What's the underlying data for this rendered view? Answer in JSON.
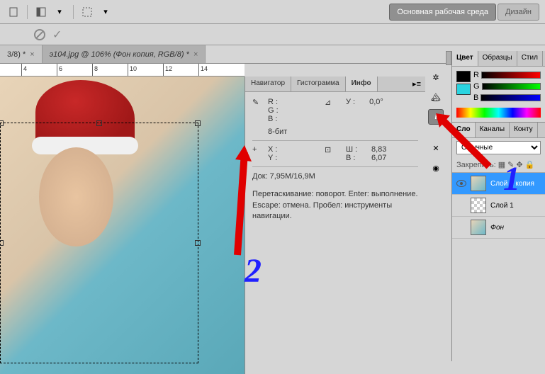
{
  "toolbar": {
    "workspace_active": "Основная рабочая среда",
    "workspace_design": "Дизайн"
  },
  "documents": {
    "tab1": "3/8) *",
    "tab2": "э104.jpg @ 106% (Фон копия, RGB/8) *"
  },
  "ruler": {
    "t4": "4",
    "t6": "6",
    "t8": "8",
    "t10": "10",
    "t12": "12",
    "t14": "14"
  },
  "info_panel": {
    "tab_nav": "Навигатор",
    "tab_hist": "Гистограмма",
    "tab_info": "Инфо",
    "r_label": "R :",
    "g_label": "G :",
    "b_label": "B :",
    "bit_depth": "8-бит",
    "x_label": "X :",
    "y_label": "Y :",
    "angle_label": "У :",
    "angle_value": "0,0°",
    "w_label": "Ш :",
    "w_value": "8,83",
    "h_label": "В :",
    "h_value": "6,07",
    "doc_size": "Док: 7,95M/16,9M",
    "hint": "Перетаскивание: поворот. Enter: выполнение. Escape: отмена. Пробел: инструменты навигации."
  },
  "color_panel": {
    "tab_color": "Цвет",
    "tab_swatches": "Образцы",
    "tab_styles": "Стил",
    "r": "R",
    "g": "G",
    "b": "B"
  },
  "layers_panel": {
    "tab_layers": "Сло",
    "tab_channels": "Каналы",
    "tab_paths": "Конту",
    "blend_mode": "Обычные",
    "lock_label": "Закрепить:",
    "layer1": "Слой 1 копия",
    "layer2": "Слой 1",
    "layer3": "Фон"
  },
  "annotations": {
    "num1": "1",
    "num2": "2"
  }
}
